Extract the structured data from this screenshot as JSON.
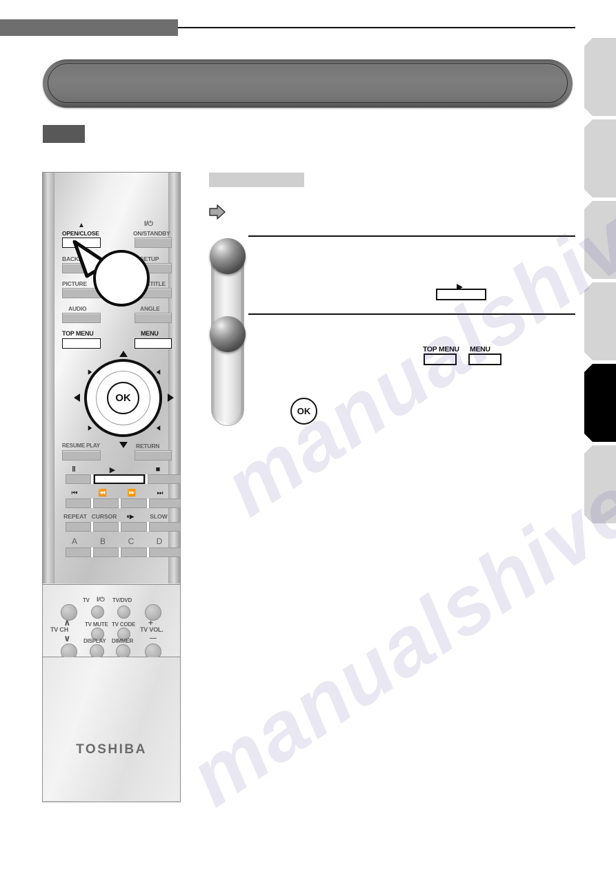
{
  "page": {
    "header_label": "",
    "chapter_title": "",
    "disc_tag": ""
  },
  "side_tabs": [
    {
      "label": "",
      "active": false
    },
    {
      "label": "",
      "active": false
    },
    {
      "label": "",
      "active": false
    },
    {
      "label": "",
      "active": false
    },
    {
      "label": "",
      "active": true
    },
    {
      "label": "",
      "active": false
    }
  ],
  "content": {
    "section_heading": "",
    "note_icon": "right-block-arrow-icon",
    "note_text": "",
    "steps": [
      {
        "number": "",
        "text": ""
      },
      {
        "number": "",
        "text": ""
      }
    ],
    "inline_graphics": {
      "play_key_label": "",
      "top_menu_label": "TOP MENU",
      "menu_label": "MENU",
      "ok_label": "OK"
    }
  },
  "remote": {
    "brand": "TOSHIBA",
    "callout": {
      "name": "open-close-callout",
      "text": ""
    },
    "top_buttons": [
      {
        "label": "OPEN/CLOSE",
        "side": "left",
        "emphasis": "white"
      },
      {
        "label": "ON/STANDBY",
        "side": "right",
        "glyph": "I/⏻",
        "emphasis": "gray"
      },
      {
        "label": "BACKLIGHT",
        "side": "left",
        "emphasis": "gray"
      },
      {
        "label": "SETUP",
        "side": "right",
        "emphasis": "gray"
      },
      {
        "label": "PICTURE",
        "side": "left",
        "emphasis": "gray"
      },
      {
        "label": "SUBTITLE",
        "side": "right",
        "emphasis": "gray"
      },
      {
        "label": "AUDIO",
        "side": "left",
        "emphasis": "gray"
      },
      {
        "label": "ANGLE",
        "side": "right",
        "emphasis": "gray"
      },
      {
        "label": "TOP MENU",
        "side": "left",
        "emphasis": "white"
      },
      {
        "label": "MENU",
        "side": "right",
        "emphasis": "white"
      }
    ],
    "eject_glyph": "▲",
    "dpad": {
      "ok_label": "OK",
      "up": "▲",
      "down": "▼",
      "left": "◀",
      "right": "▶"
    },
    "mid_buttons": [
      {
        "label": "RESUME PLAY",
        "side": "left"
      },
      {
        "label": "RETURN",
        "side": "right"
      }
    ],
    "transport_rows": [
      {
        "keys": [
          "‖",
          "▶",
          "■"
        ],
        "names": [
          "pause-button",
          "play-button",
          "stop-button"
        ]
      },
      {
        "keys": [
          "⏮",
          "⏪",
          "⏩",
          "⏭"
        ],
        "names": [
          "previous-button",
          "rewind-button",
          "fast-forward-button",
          "next-button"
        ]
      },
      {
        "keys": [
          "REPEAT",
          "CURSOR",
          "⏸▶",
          "SLOW"
        ],
        "names": [
          "repeat-button",
          "cursor-button",
          "step-button",
          "slow-button"
        ]
      },
      {
        "keys": [
          "A",
          "B",
          "C",
          "D"
        ],
        "names": [
          "a-button",
          "b-button",
          "c-button",
          "d-button"
        ]
      }
    ],
    "tv_section": {
      "labels": [
        {
          "text": "TV",
          "name": "tv-label"
        },
        {
          "text": "I/⏻",
          "name": "tv-power-label"
        },
        {
          "text": "TV/DVD",
          "name": "tv-dvd-label"
        },
        {
          "text": "TV MUTE",
          "name": "tv-mute-label"
        },
        {
          "text": "TV CODE",
          "name": "tv-code-label"
        },
        {
          "text": "DISPLAY",
          "name": "display-label"
        },
        {
          "text": "DIMMER",
          "name": "dimmer-label"
        },
        {
          "text": "TV CH",
          "name": "tv-ch-label"
        },
        {
          "text": "TV VOL.",
          "name": "tv-vol-label"
        },
        {
          "text": "+",
          "name": "vol-up-label"
        },
        {
          "text": "—",
          "name": "vol-down-label"
        },
        {
          "text": "∧",
          "name": "ch-up-label"
        },
        {
          "text": "∨",
          "name": "ch-down-label"
        }
      ]
    }
  },
  "watermark": {
    "line1": "manualshive.com",
    "line2": "manualshive.com"
  },
  "colors": {
    "header_gray": "#6e6e6e",
    "banner_gray": "#7b7b7b",
    "tab_gray": "#d4d4d4",
    "tab_active": "#000000",
    "section_bar": "#cfcfcf",
    "ink": "#111111"
  }
}
